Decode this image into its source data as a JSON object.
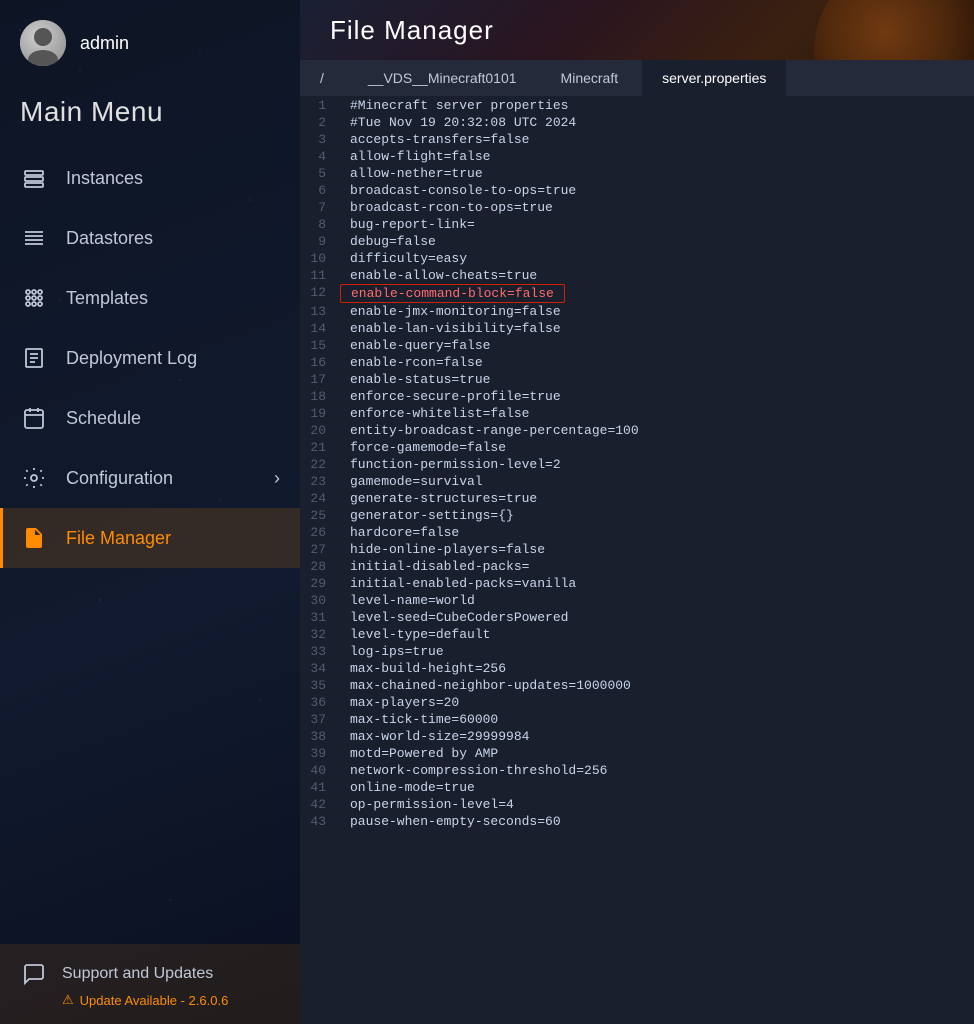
{
  "sidebar": {
    "username": "admin",
    "main_menu_title": "Main Menu",
    "nav_items": [
      {
        "id": "instances",
        "label": "Instances",
        "icon": "instances-icon"
      },
      {
        "id": "datastores",
        "label": "Datastores",
        "icon": "datastores-icon"
      },
      {
        "id": "templates",
        "label": "Templates",
        "icon": "templates-icon"
      },
      {
        "id": "deployment-log",
        "label": "Deployment Log",
        "icon": "deployment-icon"
      },
      {
        "id": "schedule",
        "label": "Schedule",
        "icon": "schedule-icon"
      },
      {
        "id": "configuration",
        "label": "Configuration",
        "icon": "configuration-icon",
        "has_arrow": true
      },
      {
        "id": "file-manager",
        "label": "File Manager",
        "icon": "file-manager-icon",
        "active": true
      }
    ],
    "support": {
      "label": "Support and Updates",
      "update_text": "Update Available - 2.6.0.6",
      "icon": "support-icon"
    }
  },
  "header": {
    "title": "File Manager"
  },
  "breadcrumb": [
    {
      "label": "/",
      "active": false
    },
    {
      "label": "__VDS__Minecraft0101",
      "active": false
    },
    {
      "label": "Minecraft",
      "active": false
    },
    {
      "label": "server.properties",
      "active": true
    }
  ],
  "file_lines": [
    {
      "num": 1,
      "text": "#Minecraft server properties",
      "highlight": false
    },
    {
      "num": 2,
      "text": "#Tue Nov 19 20:32:08 UTC 2024",
      "highlight": false
    },
    {
      "num": 3,
      "text": "accepts-transfers=false",
      "highlight": false
    },
    {
      "num": 4,
      "text": "allow-flight=false",
      "highlight": false
    },
    {
      "num": 5,
      "text": "allow-nether=true",
      "highlight": false
    },
    {
      "num": 6,
      "text": "broadcast-console-to-ops=true",
      "highlight": false
    },
    {
      "num": 7,
      "text": "broadcast-rcon-to-ops=true",
      "highlight": false
    },
    {
      "num": 8,
      "text": "bug-report-link=",
      "highlight": false
    },
    {
      "num": 9,
      "text": "debug=false",
      "highlight": false
    },
    {
      "num": 10,
      "text": "difficulty=easy",
      "highlight": false
    },
    {
      "num": 11,
      "text": "enable-allow-cheats=true",
      "highlight": false
    },
    {
      "num": 12,
      "text": "enable-command-block=false",
      "highlight": true
    },
    {
      "num": 13,
      "text": "enable-jmx-monitoring=false",
      "highlight": false
    },
    {
      "num": 14,
      "text": "enable-lan-visibility=false",
      "highlight": false
    },
    {
      "num": 15,
      "text": "enable-query=false",
      "highlight": false
    },
    {
      "num": 16,
      "text": "enable-rcon=false",
      "highlight": false
    },
    {
      "num": 17,
      "text": "enable-status=true",
      "highlight": false
    },
    {
      "num": 18,
      "text": "enforce-secure-profile=true",
      "highlight": false
    },
    {
      "num": 19,
      "text": "enforce-whitelist=false",
      "highlight": false
    },
    {
      "num": 20,
      "text": "entity-broadcast-range-percentage=100",
      "highlight": false
    },
    {
      "num": 21,
      "text": "force-gamemode=false",
      "highlight": false
    },
    {
      "num": 22,
      "text": "function-permission-level=2",
      "highlight": false
    },
    {
      "num": 23,
      "text": "gamemode=survival",
      "highlight": false
    },
    {
      "num": 24,
      "text": "generate-structures=true",
      "highlight": false
    },
    {
      "num": 25,
      "text": "generator-settings={}",
      "highlight": false
    },
    {
      "num": 26,
      "text": "hardcore=false",
      "highlight": false
    },
    {
      "num": 27,
      "text": "hide-online-players=false",
      "highlight": false
    },
    {
      "num": 28,
      "text": "initial-disabled-packs=",
      "highlight": false
    },
    {
      "num": 29,
      "text": "initial-enabled-packs=vanilla",
      "highlight": false
    },
    {
      "num": 30,
      "text": "level-name=world",
      "highlight": false
    },
    {
      "num": 31,
      "text": "level-seed=CubeCodersPowered",
      "highlight": false
    },
    {
      "num": 32,
      "text": "level-type=default",
      "highlight": false
    },
    {
      "num": 33,
      "text": "log-ips=true",
      "highlight": false
    },
    {
      "num": 34,
      "text": "max-build-height=256",
      "highlight": false
    },
    {
      "num": 35,
      "text": "max-chained-neighbor-updates=1000000",
      "highlight": false
    },
    {
      "num": 36,
      "text": "max-players=20",
      "highlight": false
    },
    {
      "num": 37,
      "text": "max-tick-time=60000",
      "highlight": false
    },
    {
      "num": 38,
      "text": "max-world-size=29999984",
      "highlight": false
    },
    {
      "num": 39,
      "text": "motd=Powered by AMP",
      "highlight": false
    },
    {
      "num": 40,
      "text": "network-compression-threshold=256",
      "highlight": false
    },
    {
      "num": 41,
      "text": "online-mode=true",
      "highlight": false
    },
    {
      "num": 42,
      "text": "op-permission-level=4",
      "highlight": false
    },
    {
      "num": 43,
      "text": "pause-when-empty-seconds=60",
      "highlight": false
    }
  ]
}
